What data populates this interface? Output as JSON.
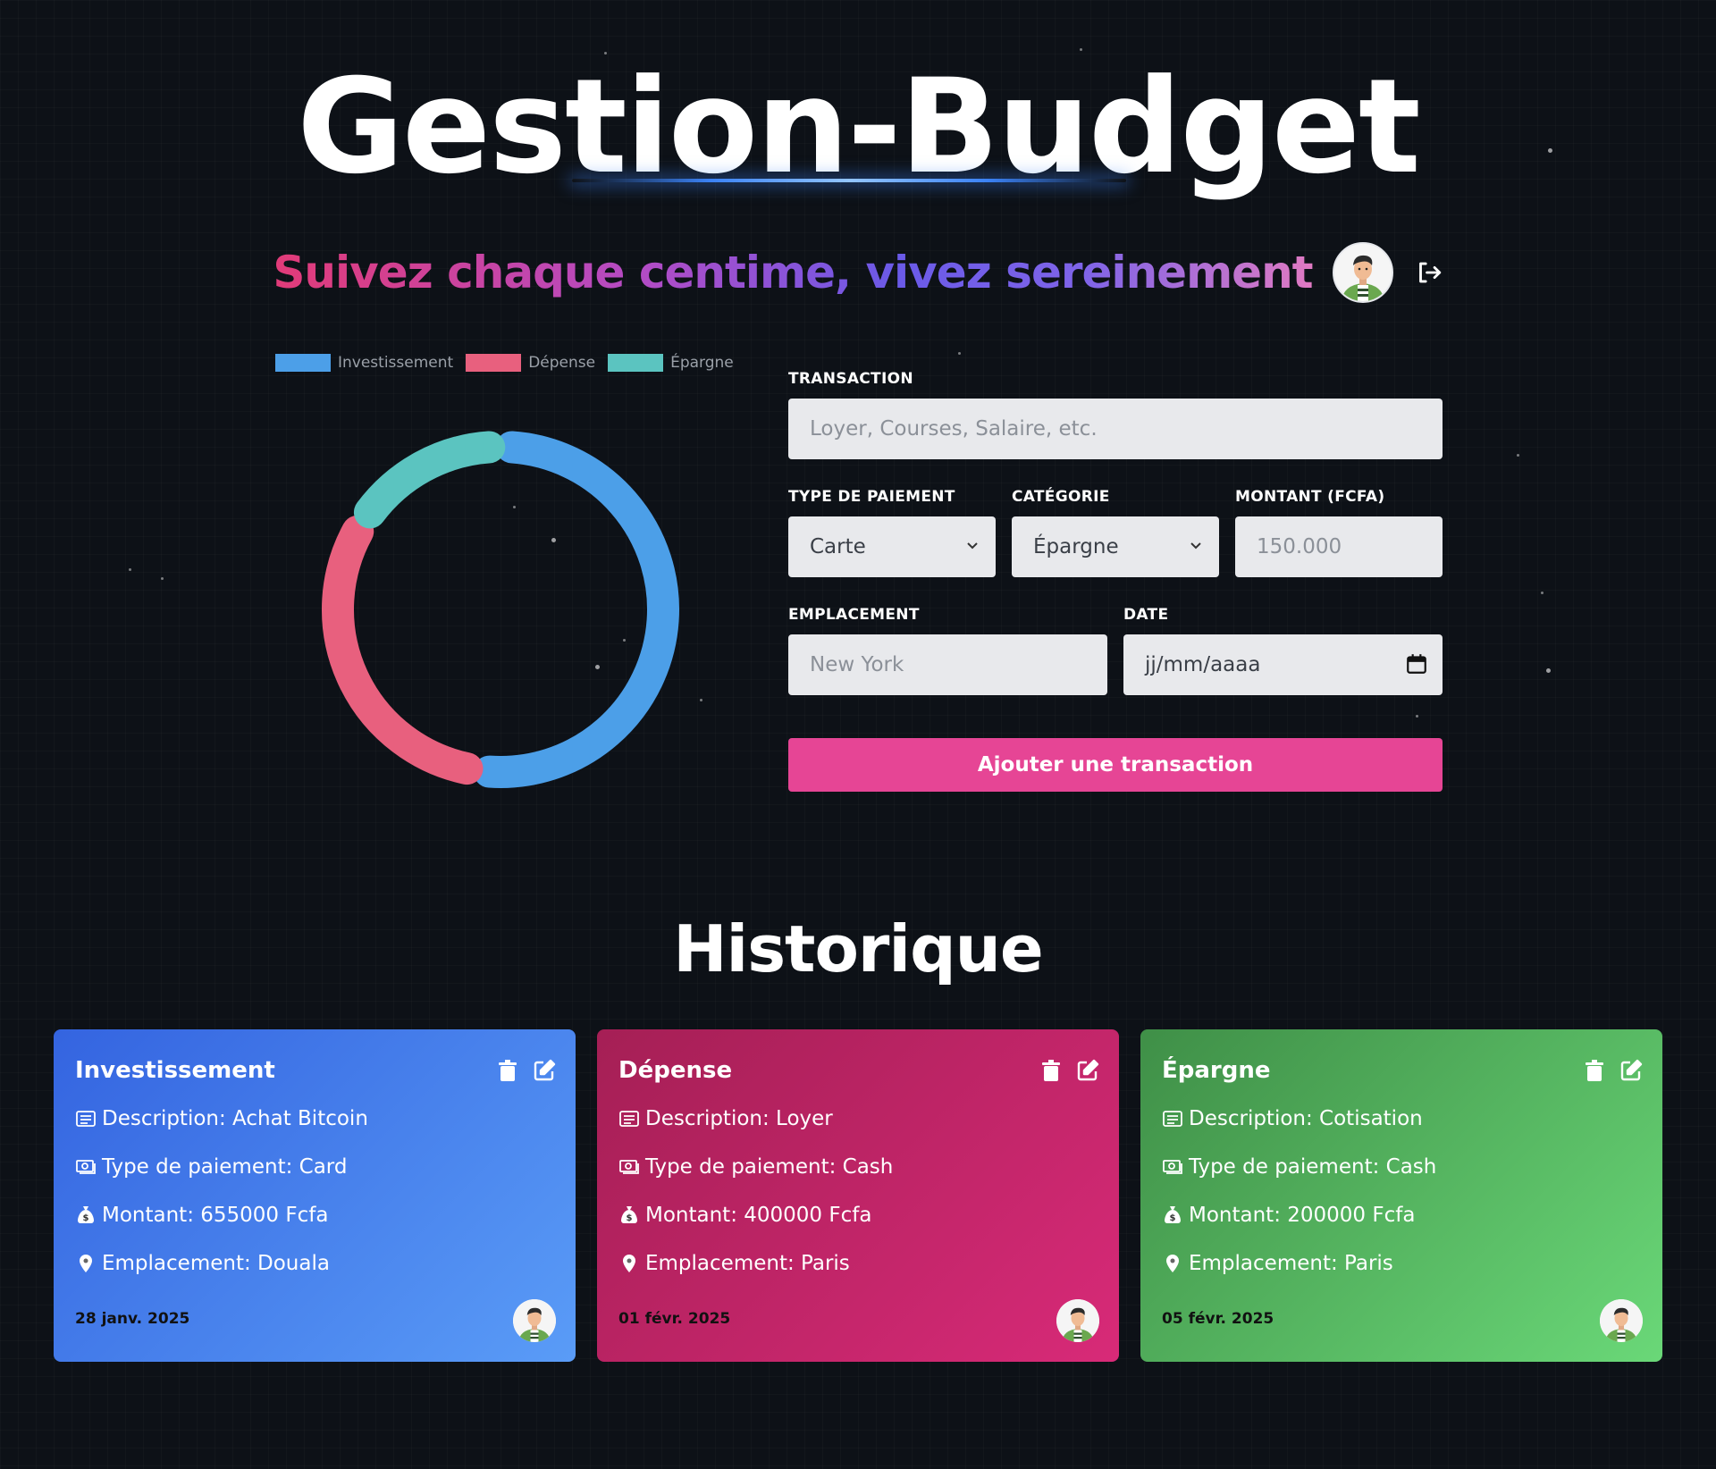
{
  "app": {
    "title": "Gestion-Budget",
    "subtitle": "Suivez chaque centime, vivez sereinement"
  },
  "icons": {
    "avatar": "user-avatar",
    "logout": "logout-icon",
    "delete": "trash-icon",
    "edit": "edit-icon",
    "description": "receipt-icon",
    "payment_type": "money-bill-icon",
    "amount": "money-bag-icon",
    "location": "map-pin-icon"
  },
  "chart_data": {
    "type": "pie",
    "variant": "doughnut",
    "categories": [
      "Investissement",
      "Dépense",
      "Épargne"
    ],
    "values": [
      655000,
      400000,
      200000
    ],
    "colors": [
      "#4c9fe8",
      "#e8607e",
      "#5bc4c0"
    ],
    "legend_position": "top"
  },
  "form": {
    "transaction": {
      "label": "Transaction",
      "placeholder": "Loyer, Courses, Salaire, etc."
    },
    "payment_type": {
      "label": "Type de paiement",
      "value": "Carte"
    },
    "category": {
      "label": "Catégorie",
      "value": "Épargne"
    },
    "amount": {
      "label": "Montant (FCFA)",
      "placeholder": "150.000"
    },
    "location": {
      "label": "Emplacement",
      "placeholder": "New York"
    },
    "date": {
      "label": "Date",
      "placeholder": "jj/mm/aaaa"
    },
    "submit_label": "Ajouter une transaction"
  },
  "history": {
    "title": "Historique",
    "cards": [
      {
        "category": "Investissement",
        "description": "Description: Achat Bitcoin",
        "payment_type": "Type de paiement: Card",
        "amount": "Montant: 655000 Fcfa",
        "location": "Emplacement: Douala",
        "date": "28 janv. 2025",
        "color_start": "#3464e0",
        "color_end": "#5a9cf7"
      },
      {
        "category": "Dépense",
        "description": "Description: Loyer",
        "payment_type": "Type de paiement: Cash",
        "amount": "Montant: 400000 Fcfa",
        "location": "Emplacement: Paris",
        "date": "01 févr. 2025",
        "color_start": "#a51f55",
        "color_end": "#d82a78"
      },
      {
        "category": "Épargne",
        "description": "Description: Cotisation",
        "payment_type": "Type de paiement: Cash",
        "amount": "Montant: 200000 Fcfa",
        "location": "Emplacement: Paris",
        "date": "05 févr. 2025",
        "color_start": "#3f8f47",
        "color_end": "#6ad878"
      }
    ]
  },
  "colors": {
    "background": "#0d1117",
    "accent_button": "#e64595",
    "input_bg": "#e8e9ec"
  }
}
